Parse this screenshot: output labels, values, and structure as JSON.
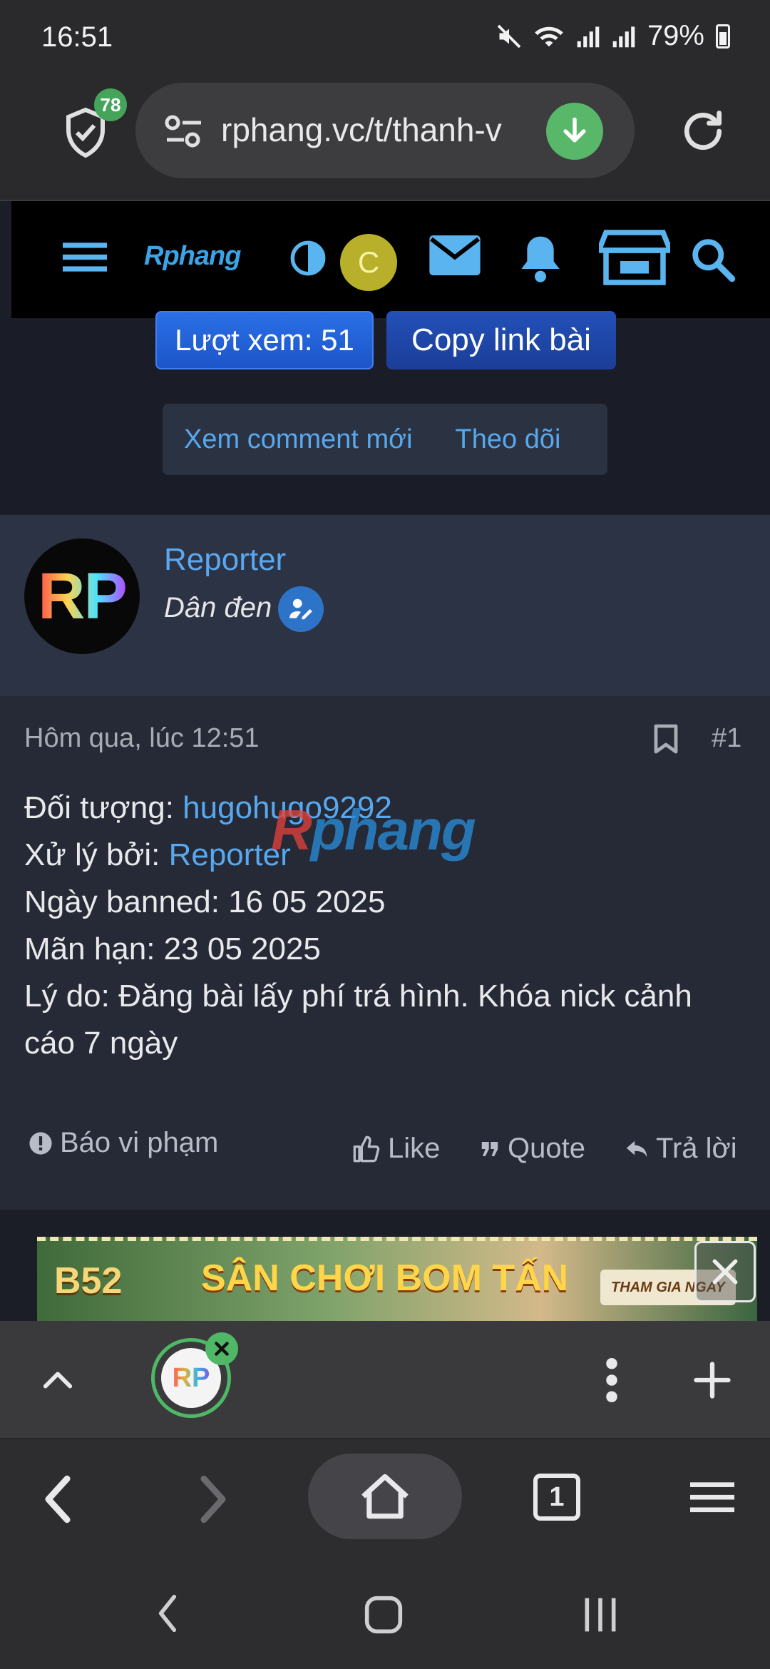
{
  "status_bar": {
    "time": "16:51",
    "battery": "79%"
  },
  "browser": {
    "url": "rphang.vc/t/thanh-v",
    "shield_count": "78",
    "open_tabs": "1"
  },
  "site": {
    "logo_text": "Rphang",
    "avatar_initial": "C"
  },
  "thread_tools": {
    "views_label": "Lượt xem: 51",
    "copy_link_label": "Copy link bài",
    "new_comments_label": "Xem comment mới",
    "follow_label": "Theo dõi"
  },
  "post": {
    "author": {
      "name": "Reporter",
      "title": "Dân đen",
      "avatar_text": "RP"
    },
    "date": "Hôm qua, lúc 12:51",
    "number": "#1",
    "lines": {
      "target_label": "Đối tượng: ",
      "target_value": "hugohugo9292",
      "handled_label": "Xử lý bởi: ",
      "handled_value": "Reporter",
      "banned_date": "Ngày banned: 16 05 2025",
      "expiry": "Mãn hạn: 23 05 2025",
      "reason": "Lý do: Đăng bài lấy phí trá hình. Khóa nick cảnh cáo 7 ngày"
    },
    "watermark": {
      "r": "R",
      "rest": "phang"
    },
    "actions": {
      "report": "Báo vi phạm",
      "like": "Like",
      "quote": "Quote",
      "reply": "Trả lời"
    }
  },
  "ad": {
    "logo": "B52",
    "headline": "SÂN CHƠI BOM TẤN",
    "cta": "THAM GIA NGAY"
  },
  "tab_strip": {
    "favicon_text": "RP"
  },
  "colors": {
    "link": "#58a8ef",
    "accent_green": "#4fb866",
    "header_bg": "#000000"
  }
}
